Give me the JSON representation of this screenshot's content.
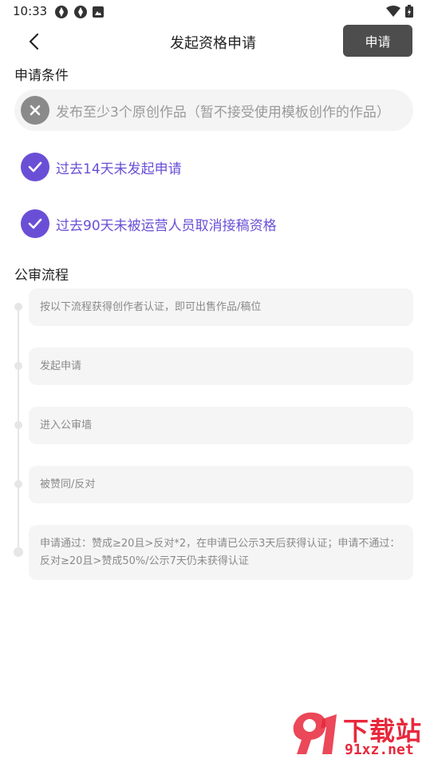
{
  "status_bar": {
    "time": "10:33"
  },
  "header": {
    "title": "发起资格申请",
    "apply_button": "申请"
  },
  "conditions": {
    "section_title": "申请条件",
    "items": [
      {
        "text": "发布至少3个原创作品（暂不接受使用模板创作的作品）",
        "met": false
      },
      {
        "text": "过去14天未发起申请",
        "met": true
      },
      {
        "text": "过去90天未被运营人员取消接稿资格",
        "met": true
      }
    ]
  },
  "process": {
    "section_title": "公审流程",
    "steps": [
      {
        "text": "按以下流程获得创作者认证，即可出售作品/稿位"
      },
      {
        "text": "发起申请"
      },
      {
        "text": "进入公审墙"
      },
      {
        "text": "被赞同/反对"
      },
      {
        "line1": "申请通过：赞成≥20且>反对*2，在申请已公示3天后获得认证；申请不通过：",
        "line2": "反对≥20且>赞成50%/公示7天仍未获得认证"
      }
    ]
  },
  "watermark": {
    "title": "下载站",
    "domain": "91xz.net"
  },
  "colors": {
    "accent": "#6a4fd6",
    "apply_button_bg": "#4d4d4d",
    "watermark": "#e8283c"
  }
}
